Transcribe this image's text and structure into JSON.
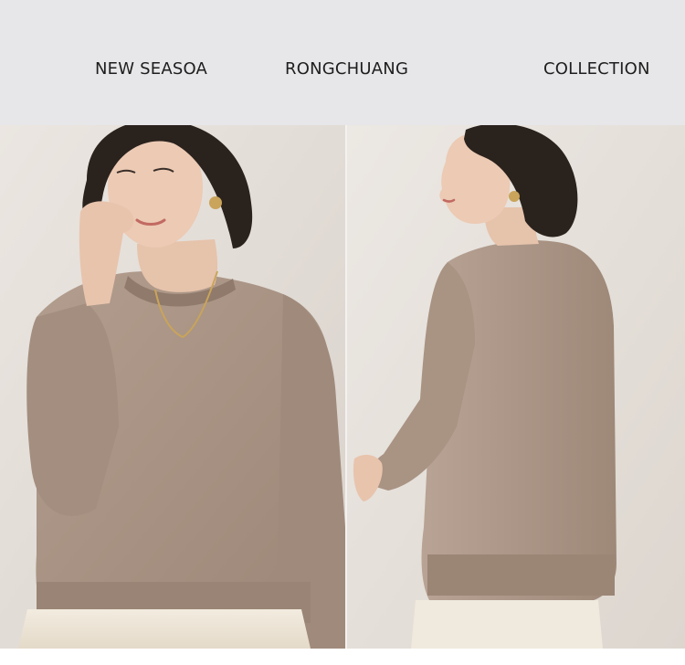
{
  "banner": {
    "labels": {
      "left": "NEW SEASOA",
      "middle": "RONGCHUANG",
      "right": "COLLECTION"
    },
    "background_color": "#e7e7e9",
    "text_color": "#1e1e1e"
  },
  "photos": {
    "front": {
      "subject": "model-front-view-sweater"
    },
    "back": {
      "subject": "model-back-view-sweater"
    }
  },
  "colors": {
    "sweater": "#a89283",
    "wall": "#e6e1dc",
    "trousers": "#efe7d8",
    "hair": "#2a221d",
    "skin": "#e8c4ad"
  }
}
